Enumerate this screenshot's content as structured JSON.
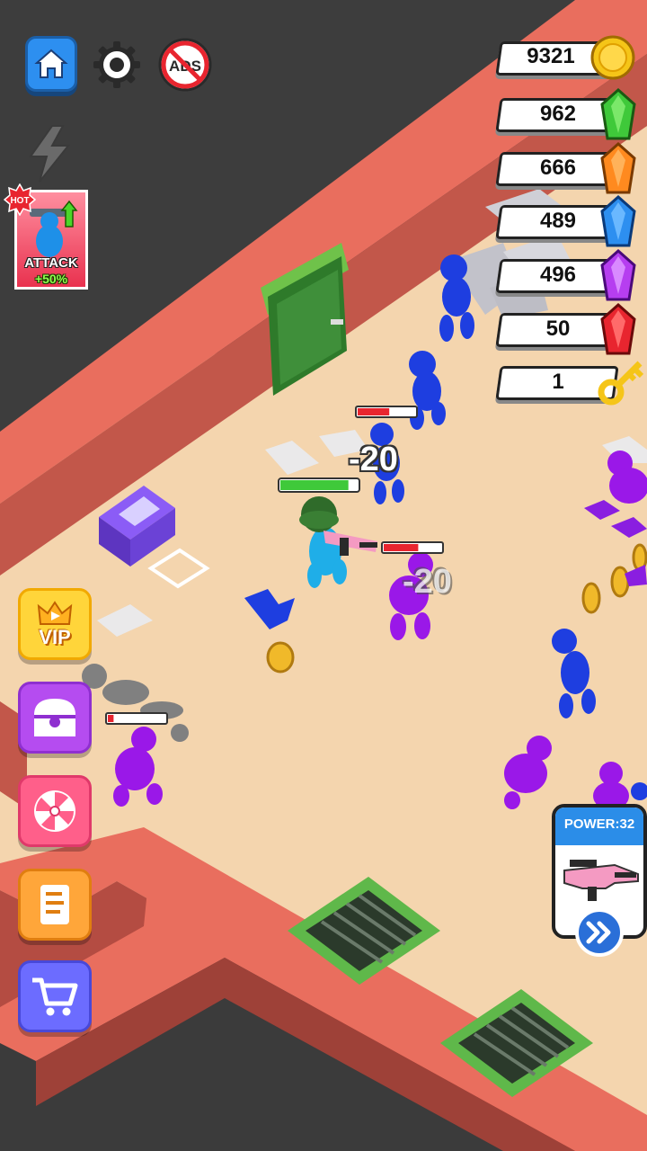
{
  "top_buttons": {
    "home": "home-icon",
    "settings": "gear-icon",
    "no_ads": "ADS"
  },
  "boost": {
    "icon": "lightning-icon",
    "hot_badge": "HOT",
    "label": "ATTACK",
    "bonus": "+50%"
  },
  "resources": [
    {
      "value": "9321",
      "icon": "gold-coin-icon",
      "color": "#f5c518"
    },
    {
      "value": "962",
      "icon": "green-gem-icon",
      "color": "#3fc93a"
    },
    {
      "value": "666",
      "icon": "orange-gem-icon",
      "color": "#ff8a1f"
    },
    {
      "value": "489",
      "icon": "blue-gem-icon",
      "color": "#2d8ff0"
    },
    {
      "value": "496",
      "icon": "purple-gem-icon",
      "color": "#b63ef0"
    },
    {
      "value": "50",
      "icon": "red-gem-icon",
      "color": "#e8252f"
    },
    {
      "value": "1",
      "icon": "gold-key-icon",
      "color": "#f5c518"
    }
  ],
  "side_menu": {
    "vip_label": "VIP",
    "chest": "treasure-chest-icon",
    "wheel": "lucky-wheel-icon",
    "quests": "scroll-icon",
    "shop": "shopping-cart-icon"
  },
  "power_card": {
    "label": "POWER:32",
    "weapon": "pink-rifle-icon",
    "upgrade": "fast-forward-icon"
  },
  "damage_numbers": [
    "-20",
    "-20"
  ],
  "health_bars": {
    "player": 0.88,
    "enemy_top": 0.55,
    "enemy_purple": 0.6,
    "enemy_left": 0.1
  },
  "colors": {
    "floor": "#f4d5ae",
    "wall": "#e96e5e",
    "void": "#3d3d3d",
    "enemy_blue": "#1e3ee0",
    "enemy_purple": "#9a18e8"
  }
}
